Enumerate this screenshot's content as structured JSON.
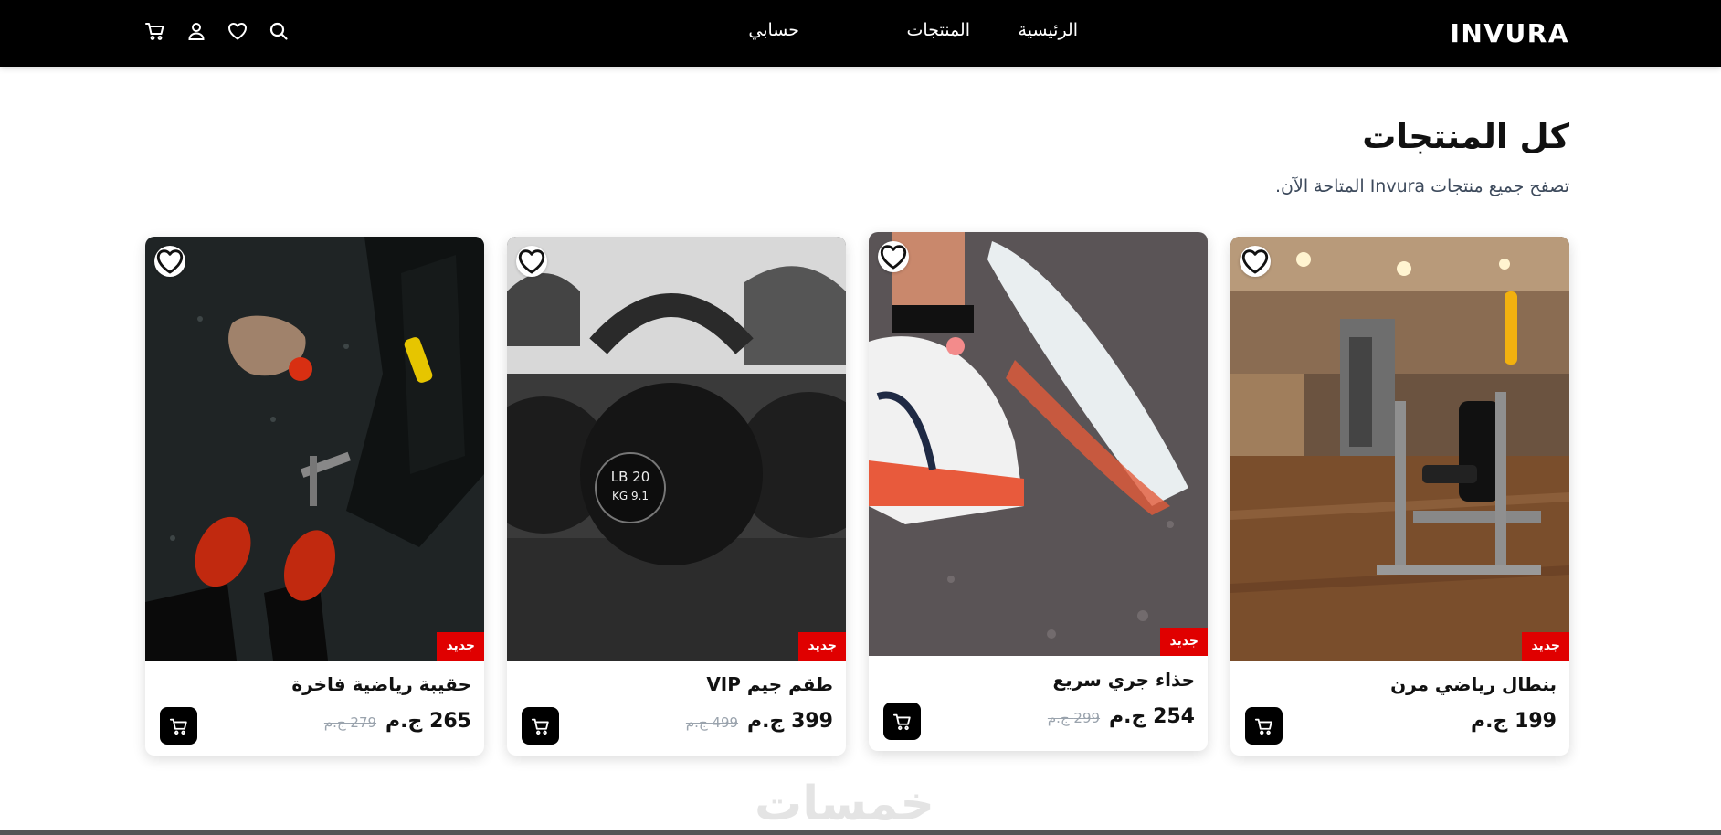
{
  "header": {
    "brand": "INVURA",
    "nav": {
      "home": "الرئيسية",
      "products": "المنتجات",
      "account": "حسابي"
    },
    "icons": [
      "search-icon",
      "heart-icon",
      "user-icon",
      "cart-icon"
    ]
  },
  "page": {
    "title": "كل المنتجات",
    "subtitle": "تصفح جميع منتجات Invura المتاحة الآن."
  },
  "products": [
    {
      "name": "بنطال رياضي مرن",
      "price": "199",
      "currency": "ج.م",
      "old_price": "",
      "badge": "جديد",
      "image": "gym machine"
    },
    {
      "name": "حذاء جري سريع",
      "price": "254",
      "currency": "ج.م",
      "old_price": "299 ج.م",
      "badge": "جديد",
      "image": "running shoes"
    },
    {
      "name": "طقم جيم VIP",
      "price": "399",
      "currency": "ج.م",
      "old_price": "499 ج.م",
      "badge": "جديد",
      "image": "kettlebells"
    },
    {
      "name": "حقيبة رياضية فاخرة",
      "price": "265",
      "currency": "ج.م",
      "old_price": "279 ج.م",
      "badge": "جديد",
      "image": "gym floor sneakers"
    }
  ],
  "watermark": "خمسات",
  "colors": {
    "header_bg": "#000000",
    "badge_red": "#e00000",
    "button_black": "#000000",
    "subtitle": "#3d4a5c"
  }
}
